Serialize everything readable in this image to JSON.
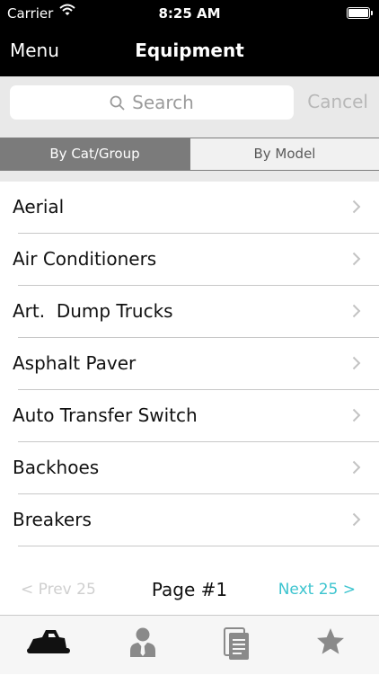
{
  "status": {
    "carrier": "Carrier",
    "time": "8:25 AM",
    "battery_level": 1.0
  },
  "nav": {
    "menu_label": "Menu",
    "title": "Equipment"
  },
  "search": {
    "placeholder": "Search",
    "cancel_label": "Cancel"
  },
  "segments": {
    "options": [
      "By Cat/Group",
      "By Model"
    ],
    "selected": "By Cat/Group"
  },
  "list": {
    "items": [
      "Aerial",
      "Air Conditioners",
      "Art.  Dump Trucks",
      "Asphalt Paver",
      "Auto Transfer Switch",
      "Backhoes",
      "Breakers"
    ]
  },
  "pagination": {
    "prev_label": "< Prev 25",
    "page_label": "Page #1",
    "next_label": "Next 25 >"
  },
  "tabbar": {
    "tabs": [
      {
        "icon": "equipment-icon",
        "selected": true
      },
      {
        "icon": "person-icon",
        "selected": false
      },
      {
        "icon": "document-icon",
        "selected": false
      },
      {
        "icon": "star-icon",
        "selected": false
      }
    ]
  },
  "colors": {
    "nav_bg": "#000000",
    "accent": "#3cc4cf",
    "segment_active": "#7b7b7b",
    "icon_inactive": "#8a8a8a",
    "icon_active": "#111111"
  }
}
